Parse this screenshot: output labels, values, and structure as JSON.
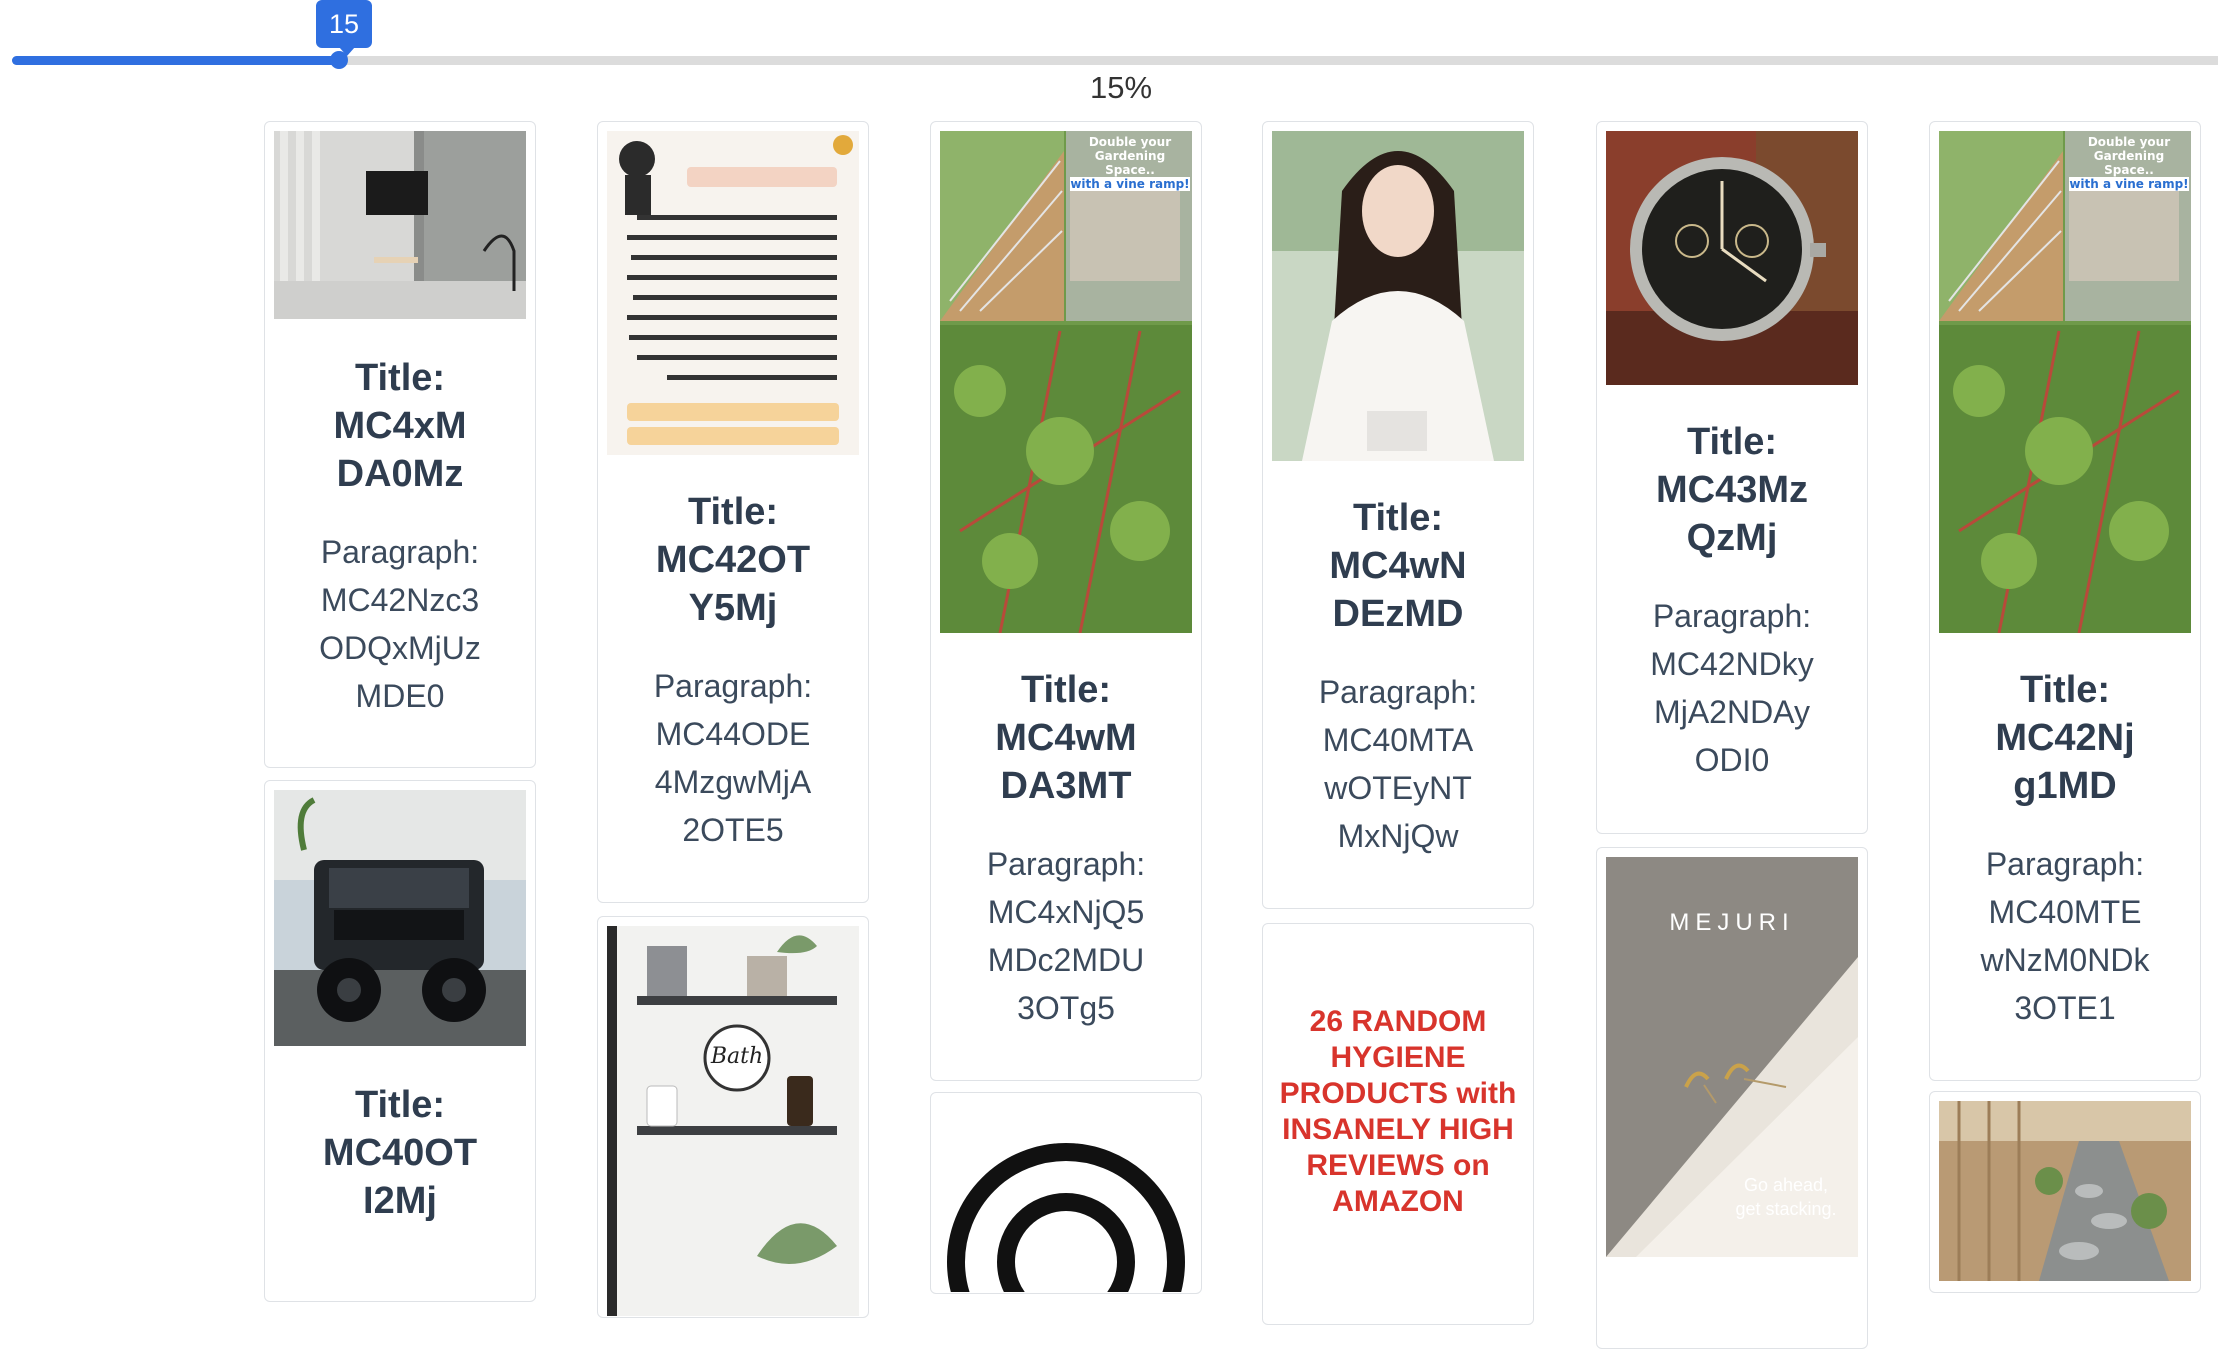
{
  "slider": {
    "value": "15",
    "percent_label": "15%",
    "fraction": 0.15
  },
  "cards": {
    "c1": {
      "title": [
        "Title:",
        "MC4xM",
        "DA0Mz"
      ],
      "para": [
        "Paragraph:",
        "MC42Nzc3",
        "ODQxMjUz",
        "MDE0"
      ],
      "image": "living-room-tv-wall"
    },
    "c2": {
      "title": [
        "Title:",
        "MC40OT",
        "I2Mj"
      ],
      "image": "black-jeep-suv"
    },
    "c3": {
      "title": [
        "Title:",
        "MC42OT",
        "Y5Mj"
      ],
      "para": [
        "Paragraph:",
        "MC44ODE",
        "4MzgwMjA",
        "2OTE5"
      ],
      "image": "arabic-text-poster"
    },
    "c4": {
      "image": "bathroom-shelves",
      "label": "Bath"
    },
    "c5": {
      "title": [
        "Title:",
        "MC4wM",
        "DA3MT"
      ],
      "para": [
        "Paragraph:",
        "MC4xNjQ5",
        "MDc2MDU",
        "3OTg5"
      ],
      "image": "cucumber-trellis-garden",
      "banner": [
        "Double your",
        "Gardening Space..",
        "with a vine ramp!"
      ]
    },
    "c6": {
      "image": "black-circle-target"
    },
    "c7": {
      "title": [
        "Title:",
        "MC4wN",
        "DEzMD"
      ],
      "para": [
        "Paragraph:",
        "MC40MTA",
        "wOTEyNT",
        "MxNjQw"
      ],
      "image": "woman-white-blouse"
    },
    "c8": {
      "image": "hygiene-products-text",
      "lines": [
        "26 RANDOM",
        "HYGIENE",
        "PRODUCTS with",
        "INSANELY HIGH",
        "REVIEWS on",
        "AMAZON"
      ]
    },
    "c9": {
      "title": [
        "Title:",
        "MC43Mz",
        "QzMj"
      ],
      "para": [
        "Paragraph:",
        "MC42NDky",
        "MjA2NDAy",
        "ODI0"
      ],
      "image": "vintage-chronograph-watch"
    },
    "c10": {
      "image": "mejuri-earrings",
      "brand": "MEJURI",
      "caption": [
        "Go ahead,",
        "get stacking."
      ]
    },
    "c11": {
      "title": [
        "Title:",
        "MC42Nj",
        "g1MD"
      ],
      "para": [
        "Paragraph:",
        "MC40MTE",
        "wNzM0NDk",
        "3OTE1"
      ],
      "image": "cucumber-trellis-garden",
      "banner": [
        "Double your",
        "Gardening Space..",
        "with a vine ramp!"
      ]
    },
    "c12": {
      "image": "garden-stone-path"
    }
  },
  "colors": {
    "accent": "#2f6fe0",
    "title": "#2f3d4f",
    "card_border": "#dfe2e6",
    "hygiene_red": "#d8342c"
  }
}
